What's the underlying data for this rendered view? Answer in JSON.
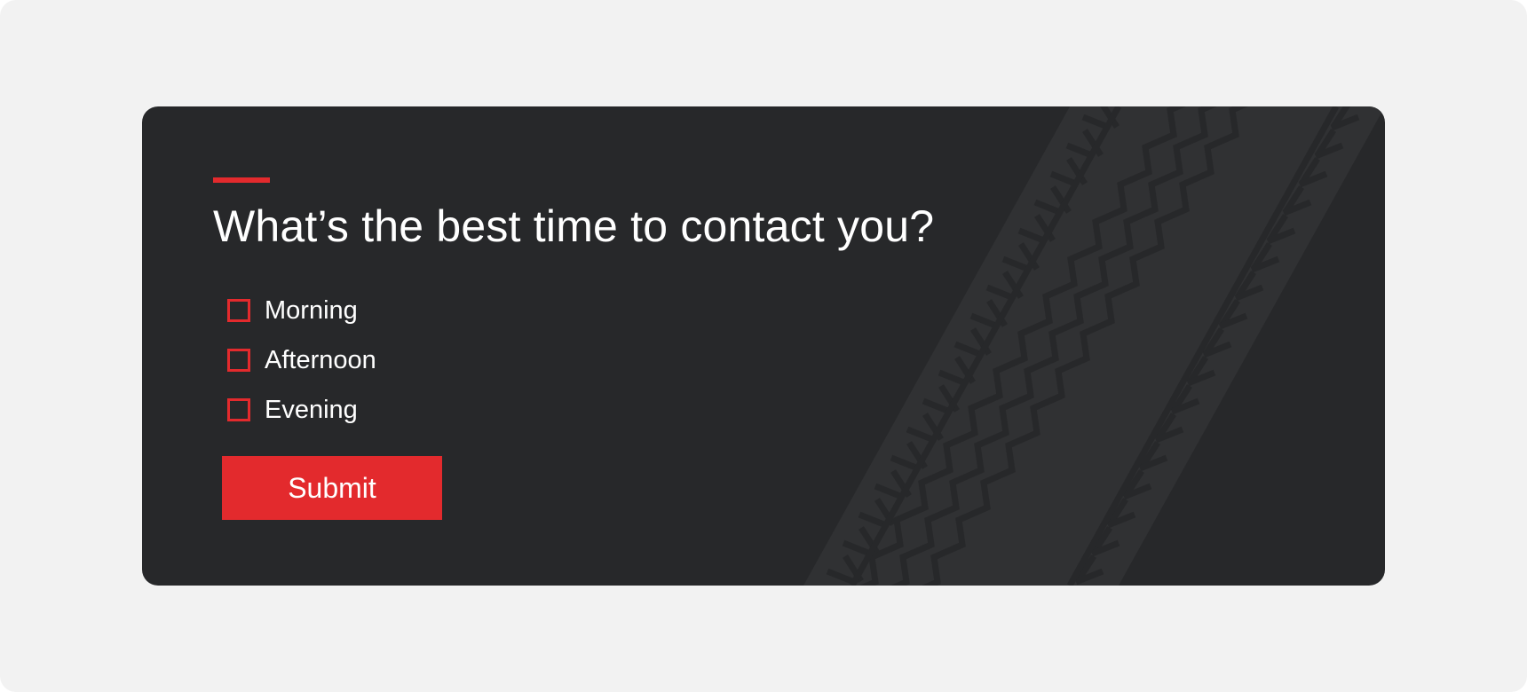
{
  "form": {
    "question": "What’s the best time to contact you?",
    "options": [
      {
        "label": "Morning",
        "checked": false
      },
      {
        "label": "Afternoon",
        "checked": false
      },
      {
        "label": "Evening",
        "checked": false
      }
    ],
    "submit_label": "Submit"
  },
  "colors": {
    "accent": "#e32a2d",
    "card_background": "#27282a",
    "page_background": "#f2f2f2",
    "text": "#ffffff",
    "tread_pattern": "#303133"
  }
}
